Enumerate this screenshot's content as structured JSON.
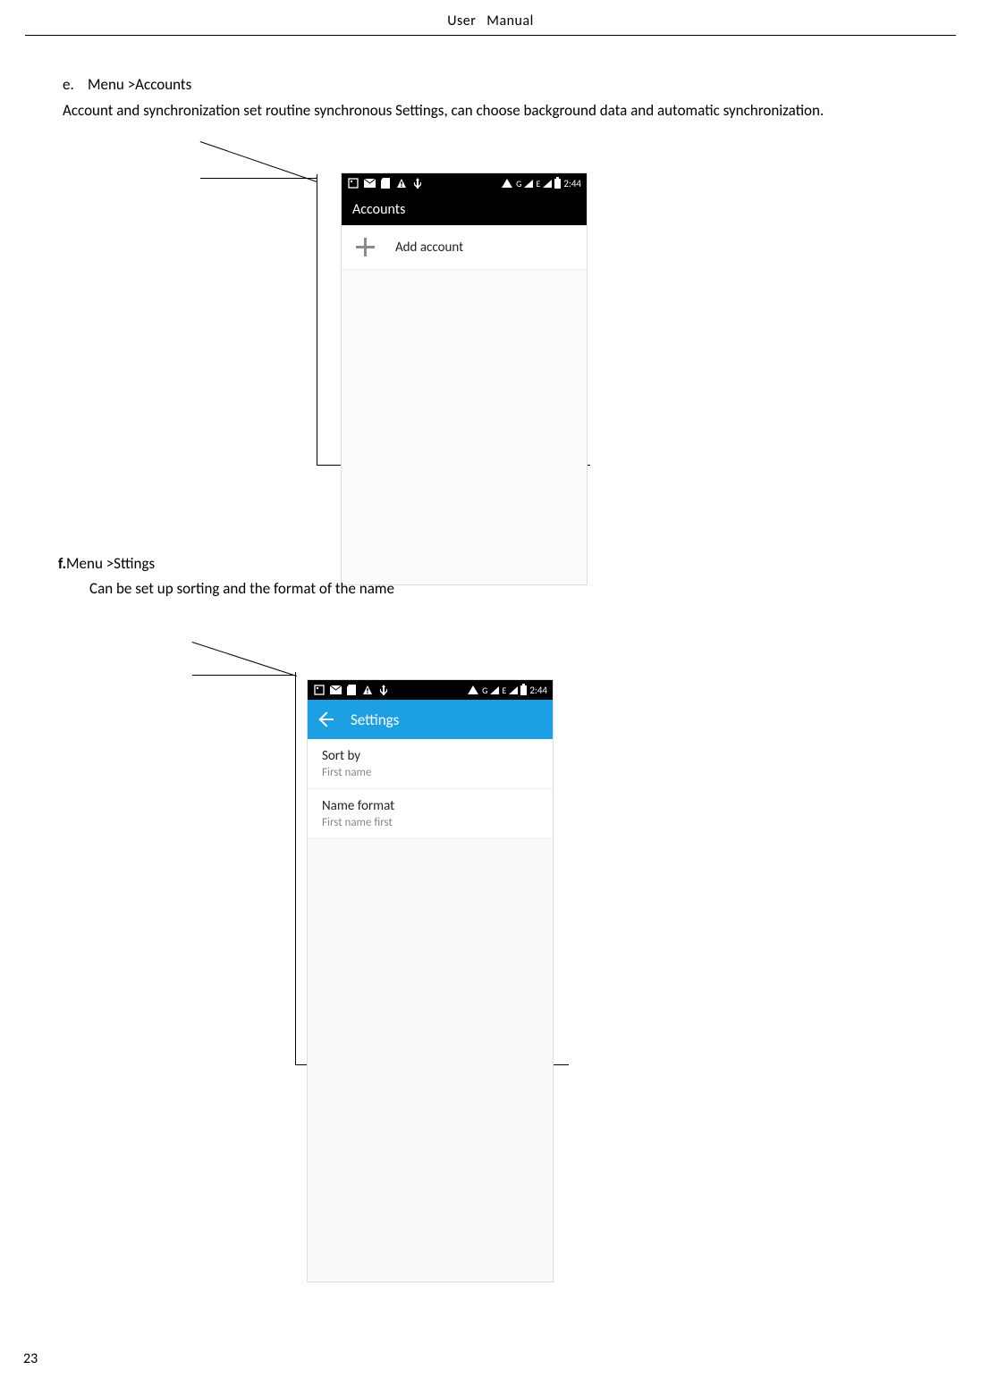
{
  "header": {
    "left": "User",
    "right": "Manual"
  },
  "sectionE": {
    "letter": "e.",
    "title": "Menu >Accounts",
    "body": "Account and synchronization set routine synchronous Settings, can choose background data and automatic synchronization."
  },
  "statusbar": {
    "networks": "G   E",
    "time": "2:44"
  },
  "phone1": {
    "title": "Accounts",
    "addAccount": "Add account"
  },
  "sectionF": {
    "letter": "f.",
    "title": "Menu >Sttings",
    "sub": "Can be set up sorting and the format of the name"
  },
  "phone2": {
    "title": "Settings",
    "row1": {
      "title": "Sort by",
      "sub": "First name"
    },
    "row2": {
      "title": "Name format",
      "sub": "First name first"
    }
  },
  "pageNumber": "23"
}
